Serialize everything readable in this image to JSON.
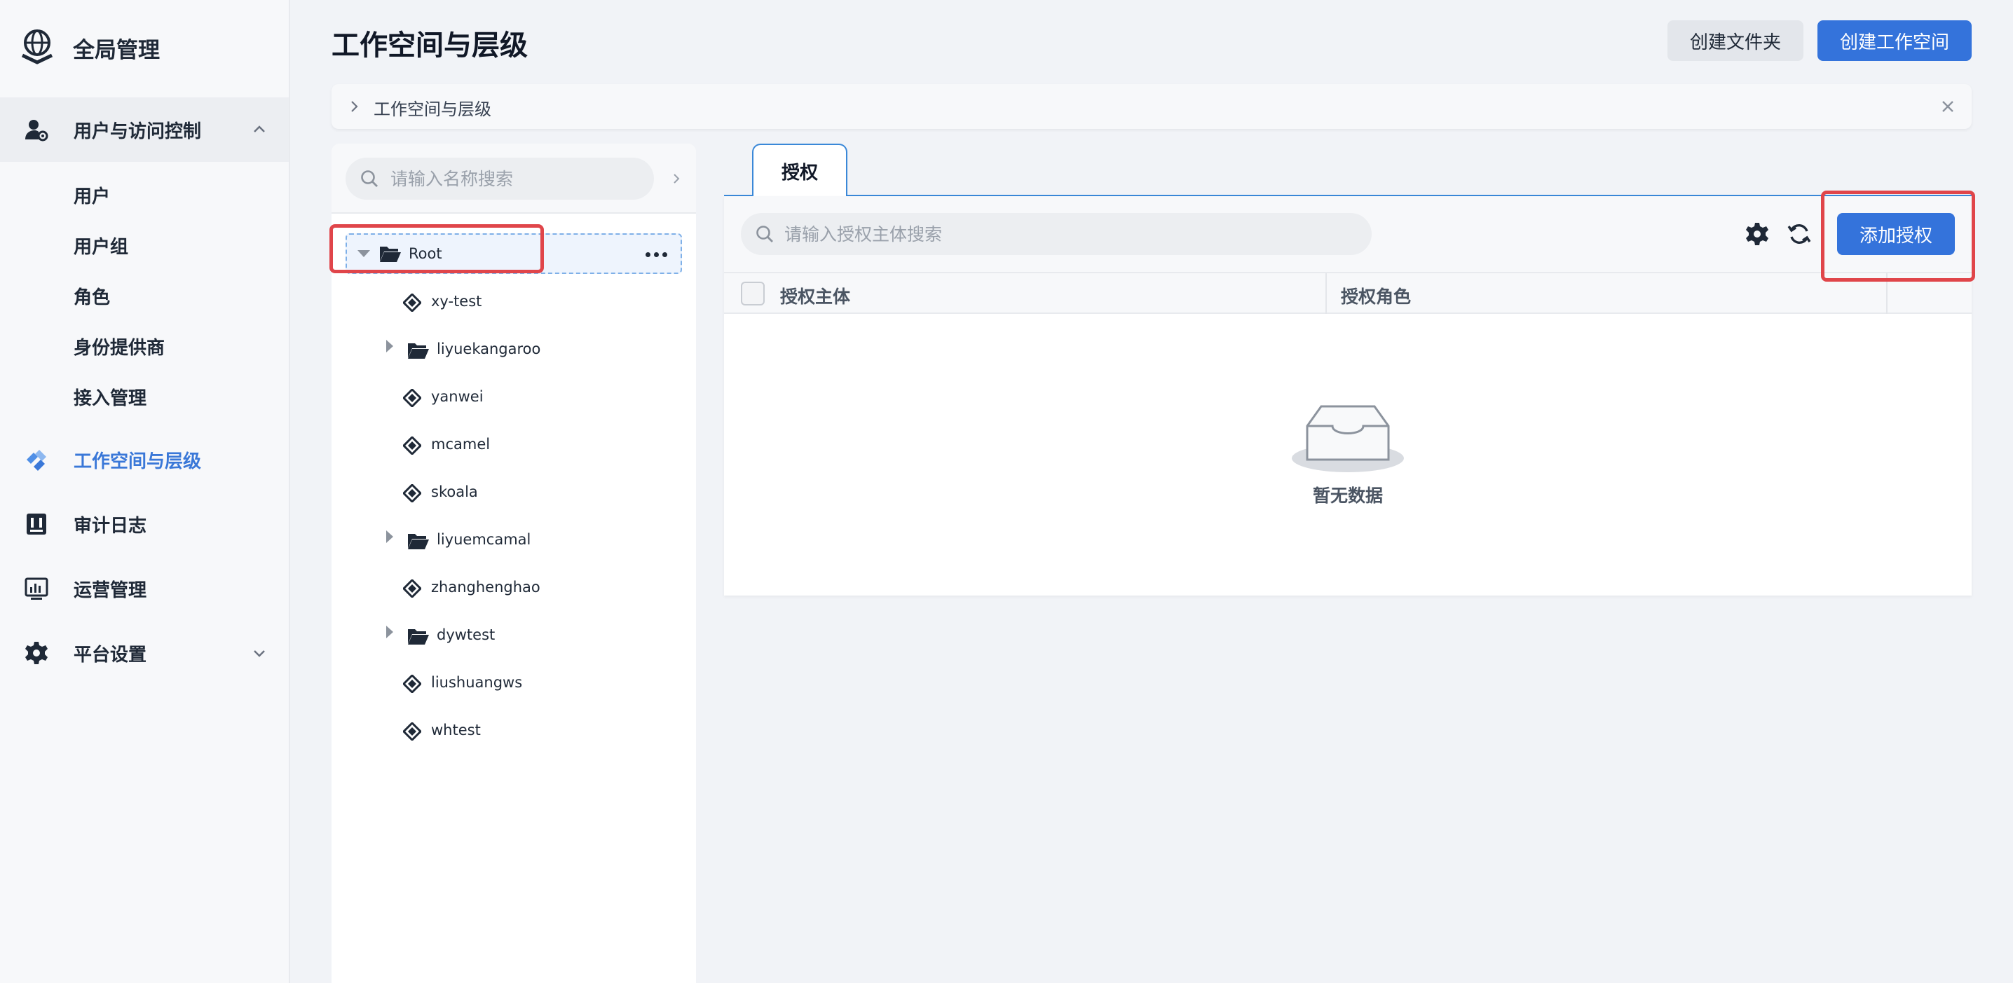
{
  "app": {
    "title": "全局管理"
  },
  "sidebar": {
    "group": {
      "label": "用户与访问控制",
      "icon": "user-gear-icon",
      "expanded": true
    },
    "sub_items": [
      {
        "label": "用户"
      },
      {
        "label": "用户组"
      },
      {
        "label": "角色"
      },
      {
        "label": "身份提供商"
      },
      {
        "label": "接入管理"
      }
    ],
    "items": [
      {
        "label": "工作空间与层级",
        "icon": "workspace-icon",
        "active": true
      },
      {
        "label": "审计日志",
        "icon": "audit-log-icon"
      },
      {
        "label": "运营管理",
        "icon": "operations-chart-icon"
      },
      {
        "label": "平台设置",
        "icon": "gear-icon"
      }
    ]
  },
  "header": {
    "title": "工作空间与层级",
    "create_folder_label": "创建文件夹",
    "create_workspace_label": "创建工作空间"
  },
  "breadcrumb": {
    "text": "工作空间与层级"
  },
  "tree": {
    "search_placeholder": "请输入名称搜索",
    "root": {
      "label": "Root",
      "expanded": true
    },
    "nodes": [
      {
        "label": "xy-test",
        "type": "workspace"
      },
      {
        "label": "liyuekangaroo",
        "type": "folder"
      },
      {
        "label": "yanwei",
        "type": "workspace"
      },
      {
        "label": "mcamel",
        "type": "workspace"
      },
      {
        "label": "skoala",
        "type": "workspace"
      },
      {
        "label": "liyuemcamal",
        "type": "folder"
      },
      {
        "label": "zhanghenghao",
        "type": "workspace"
      },
      {
        "label": "dywtest",
        "type": "folder"
      },
      {
        "label": "liushuangws",
        "type": "workspace"
      },
      {
        "label": "whtest",
        "type": "workspace"
      }
    ]
  },
  "content": {
    "tab_label": "授权",
    "search_placeholder": "请输入授权主体搜索",
    "add_button_label": "添加授权",
    "columns": [
      "授权主体",
      "授权角色"
    ],
    "empty_text": "暂无数据"
  },
  "colors": {
    "accent": "#3473db",
    "highlight": "#e0454a"
  }
}
